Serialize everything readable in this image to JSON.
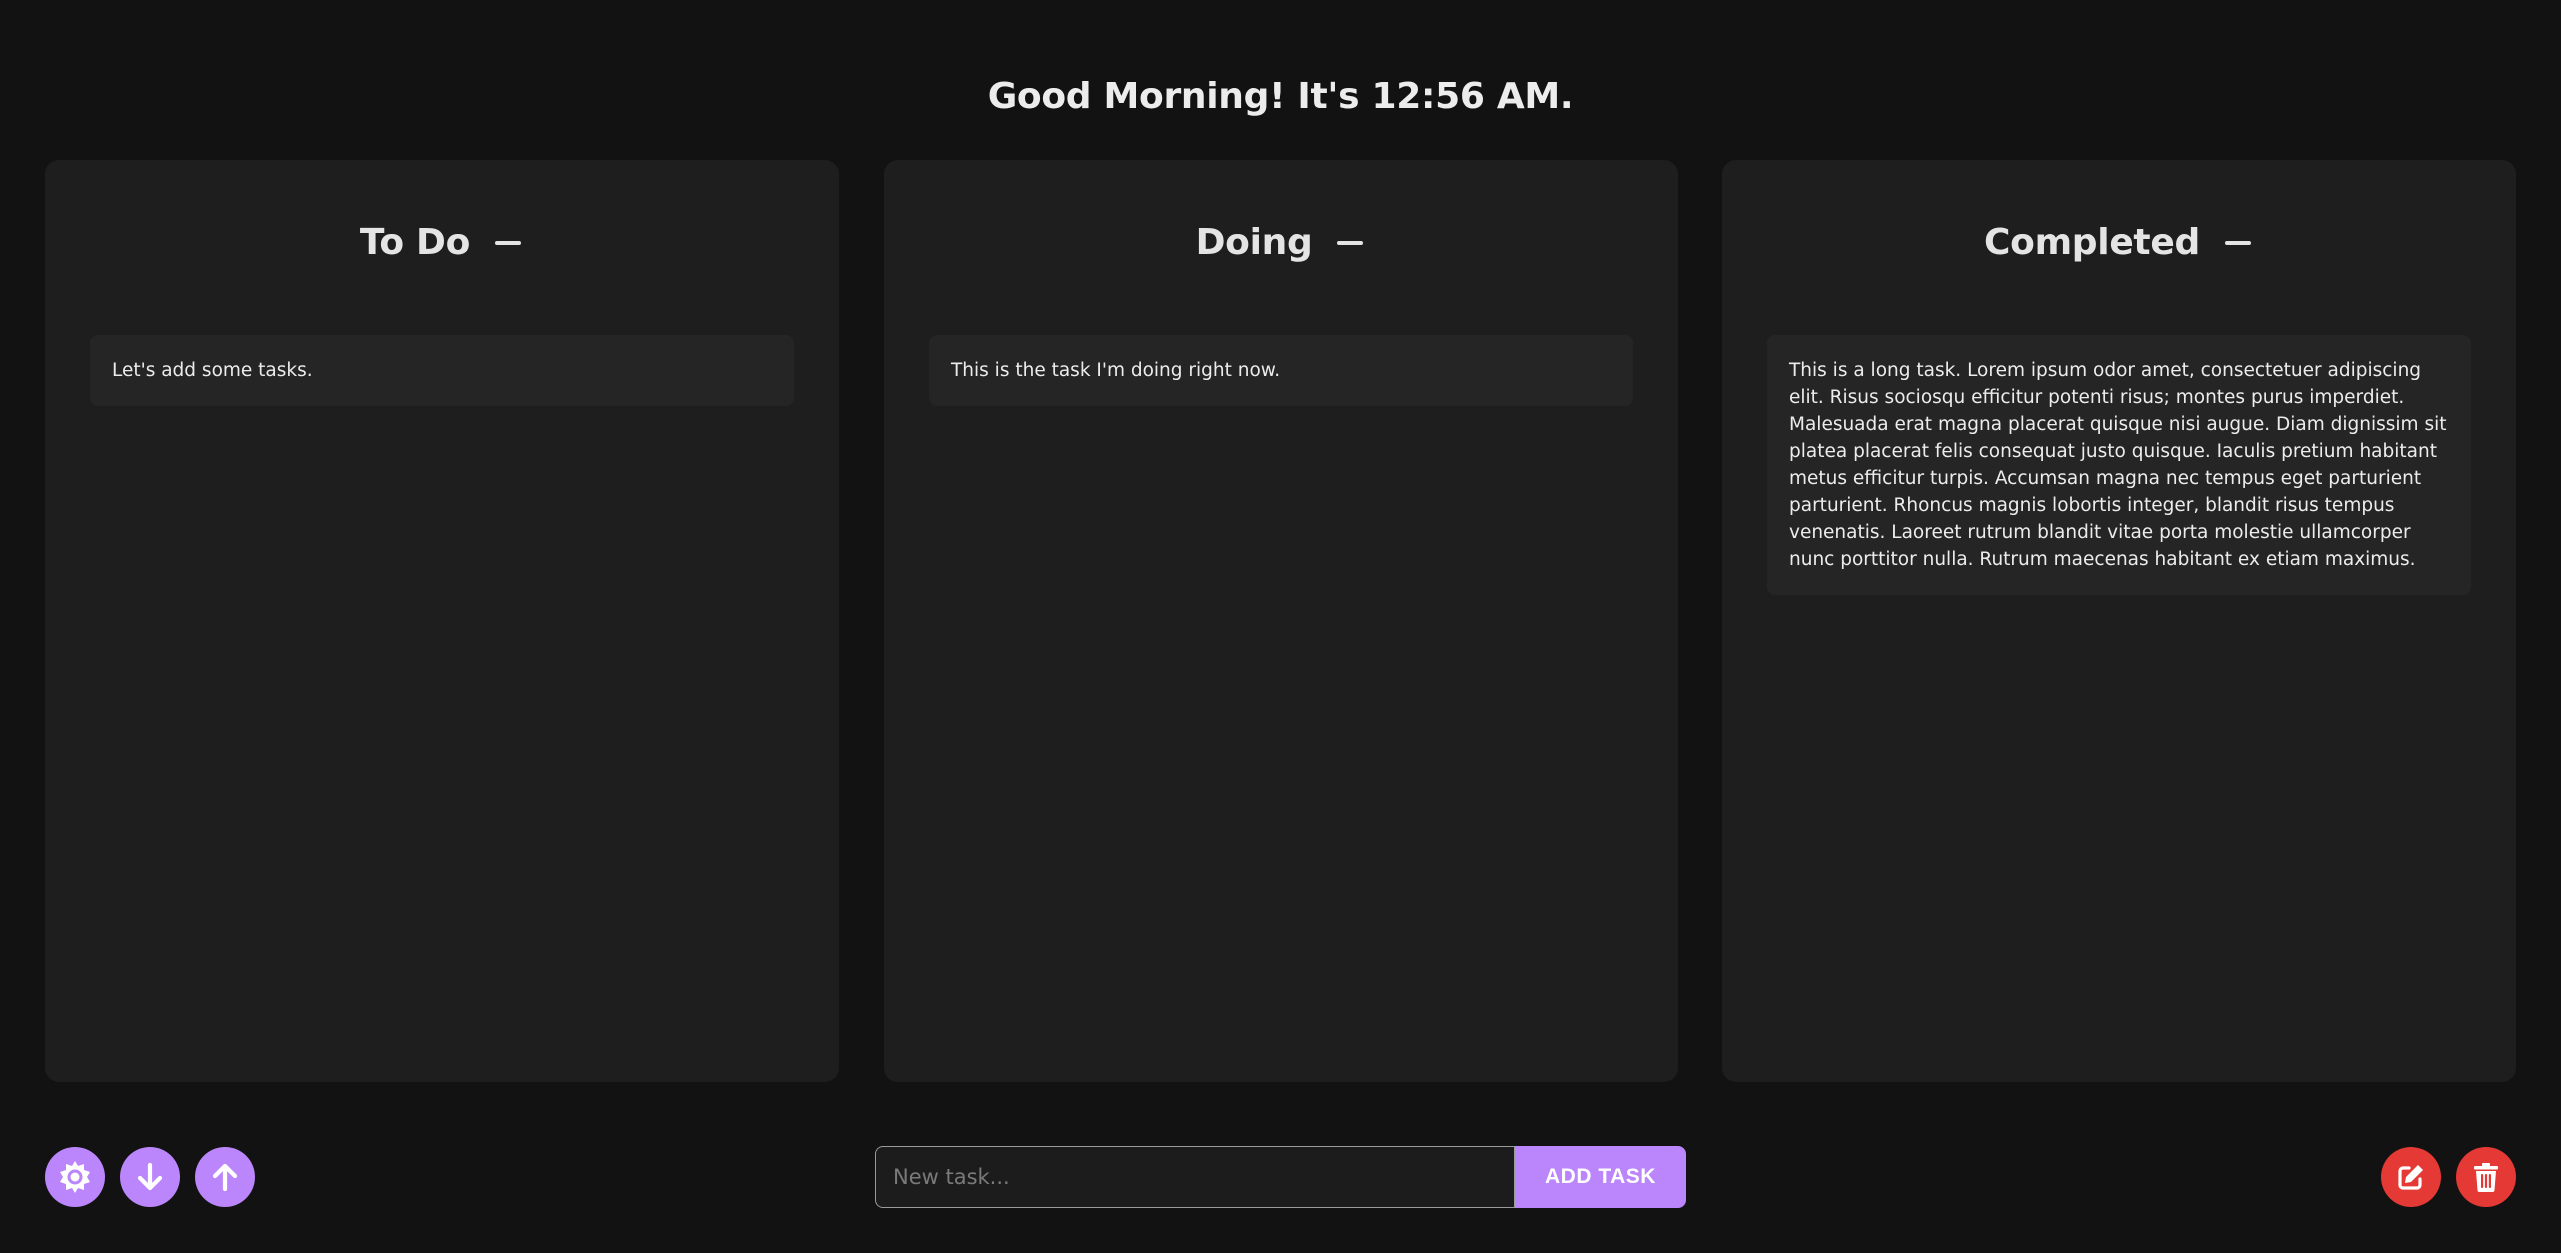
{
  "header": {
    "greeting": "Good Morning! It's 12:56 AM."
  },
  "columns": [
    {
      "title": "To Do",
      "tasks": [
        "Let's add some tasks."
      ]
    },
    {
      "title": "Doing",
      "tasks": [
        "This is the task I'm doing right now."
      ]
    },
    {
      "title": "Completed",
      "tasks": [
        "This is a long task. Lorem ipsum odor amet, consectetuer adipiscing elit. Risus sociosqu efficitur potenti risus; montes purus imperdiet. Malesuada erat magna placerat quisque nisi augue. Diam dignissim sit platea placerat felis consequat justo quisque. Iaculis pretium habitant metus efficitur turpis. Accumsan magna nec tempus eget parturient parturient. Rhoncus magnis lobortis integer, blandit risus tempus venenatis. Laoreet rutrum blandit vitae porta molestie ullamcorper nunc porttitor nulla. Rutrum maecenas habitant ex etiam maximus."
      ]
    }
  ],
  "add_task": {
    "placeholder": "New task...",
    "value": "",
    "button_label": "ADD TASK"
  },
  "toolbar_left": {
    "icons": [
      "theme-toggle-icon",
      "download-icon",
      "upload-icon"
    ]
  },
  "toolbar_right": {
    "icons": [
      "edit-icon",
      "trash-icon"
    ]
  },
  "colors": {
    "background": "#121212",
    "column": "#1e1e1e",
    "task": "#252525",
    "accent": "#bb86fc",
    "danger": "#e53935"
  }
}
